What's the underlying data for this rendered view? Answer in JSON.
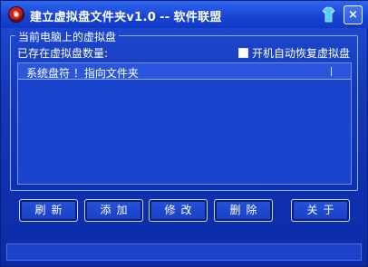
{
  "window": {
    "title": "建立虚拟盘文件夹v1.0",
    "title_sep": "--",
    "title_publisher": "软件联盟",
    "close_glyph": "×"
  },
  "icons": {
    "app": "app-icon",
    "skin": "shirt-icon",
    "close": "close-icon"
  },
  "group": {
    "title": "当前电脑上的虚拟盘",
    "count_label": "已存在虚拟盘数量:",
    "checkbox_label": "开机自动恢复虚拟盘",
    "checkbox_checked": false
  },
  "list": {
    "header": "系统盘符  ！指向文件夹"
  },
  "buttons": {
    "refresh": "刷新",
    "add": "添加",
    "modify": "修改",
    "delete": "删除",
    "about": "关于"
  },
  "colors": {
    "window_bg": "#1538b8",
    "title_bg": "#1846d5",
    "text": "#ffffff",
    "border_light": "#8fb0ff"
  }
}
